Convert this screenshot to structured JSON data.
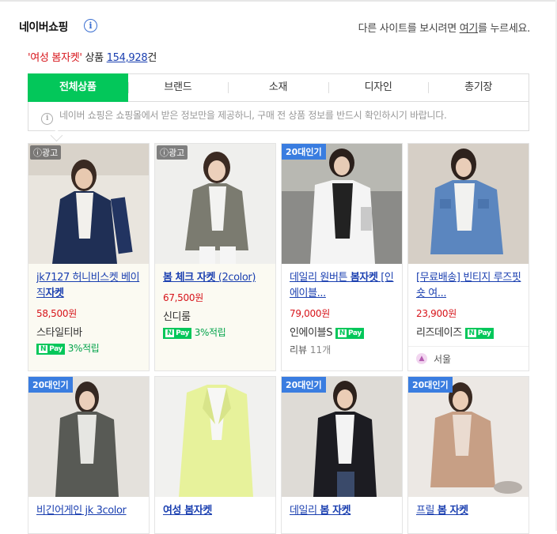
{
  "header": {
    "brand": "네이버쇼핑",
    "other_site_prefix": "다른 사이트를 보시려면 ",
    "other_site_link": "여기",
    "other_site_suffix": "를 누르세요."
  },
  "result": {
    "query": "'여성 봄자켓'",
    "label": " 상품 ",
    "count": "154,928",
    "unit": "건"
  },
  "tabs": [
    "전체상품",
    "브랜드",
    "소재",
    "디자인",
    "총기장"
  ],
  "notice": "네이버 쇼핑은 쇼핑몰에서 받은 정보만을 제공하니, 구매 전 상품 정보를 반드시 확인하시기 바랍니다.",
  "badges": {
    "ad": "광고",
    "popular": "20대인기"
  },
  "npay_label": {
    "n": "N",
    "pay": "Pay"
  },
  "products": [
    {
      "title_plain": "jk7127 허니비스켓 베이직",
      "title_bold": "자켓",
      "price": "58,500원",
      "mall": "스타일티바",
      "point": "3%적립"
    },
    {
      "title_bold": "봄 체크 자켓",
      "title_plain": " (2color)",
      "price": "67,500원",
      "mall": "신디룸",
      "point": "3%적립"
    },
    {
      "title_plain": "데일리 원버튼 ",
      "title_bold": "봄자켓",
      "title_more": " [인에이블...",
      "price": "79,000원",
      "mall": "인에이블S",
      "review_label": "리뷰",
      "review_count": "11개"
    },
    {
      "title_plain": "[무료배송] 빈티지 루즈핏 숏 여...",
      "price": "23,900원",
      "mall": "리즈데이즈",
      "location": "서울"
    },
    {
      "title_plain": "비긴어게인 jk 3color"
    },
    {
      "title_bold": "여성 봄자켓"
    },
    {
      "title_plain": "데일리 ",
      "title_bold": "봄 자켓"
    },
    {
      "title_plain": "프릴 ",
      "title_bold": "봄 자켓"
    }
  ],
  "colors": {
    "naver_green": "#03c75a",
    "link_blue": "#1a3fb0",
    "price_red": "#d7141a",
    "badge_blue": "#3a7de0"
  }
}
